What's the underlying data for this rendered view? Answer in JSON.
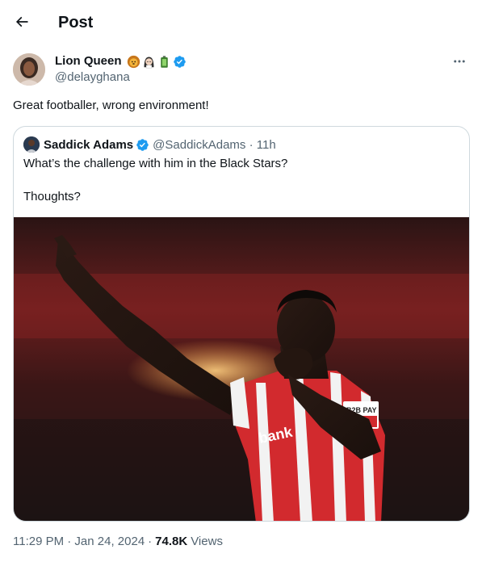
{
  "header": {
    "title": "Post"
  },
  "post": {
    "author_name": "Lion Queen",
    "author_handle": "@delayghana",
    "text": "Great footballer, wrong environment!",
    "timestamp": "11:29 PM · Jan 24, 2024",
    "views_count": "74.8K",
    "views_label": "Views"
  },
  "quote": {
    "author_name": "Saddick Adams",
    "meta": "@SaddickAdams · 11h",
    "text_line1": "What’s the challenge with him in the Black Stars?",
    "text_line2": "Thoughts?",
    "image_jersey_sponsor": "bank",
    "image_badge": "B2B PAY"
  },
  "colors": {
    "verified": "#1d9bf0",
    "secondary": "#536471",
    "primary": "#0f1419",
    "border": "#cfd9de"
  }
}
